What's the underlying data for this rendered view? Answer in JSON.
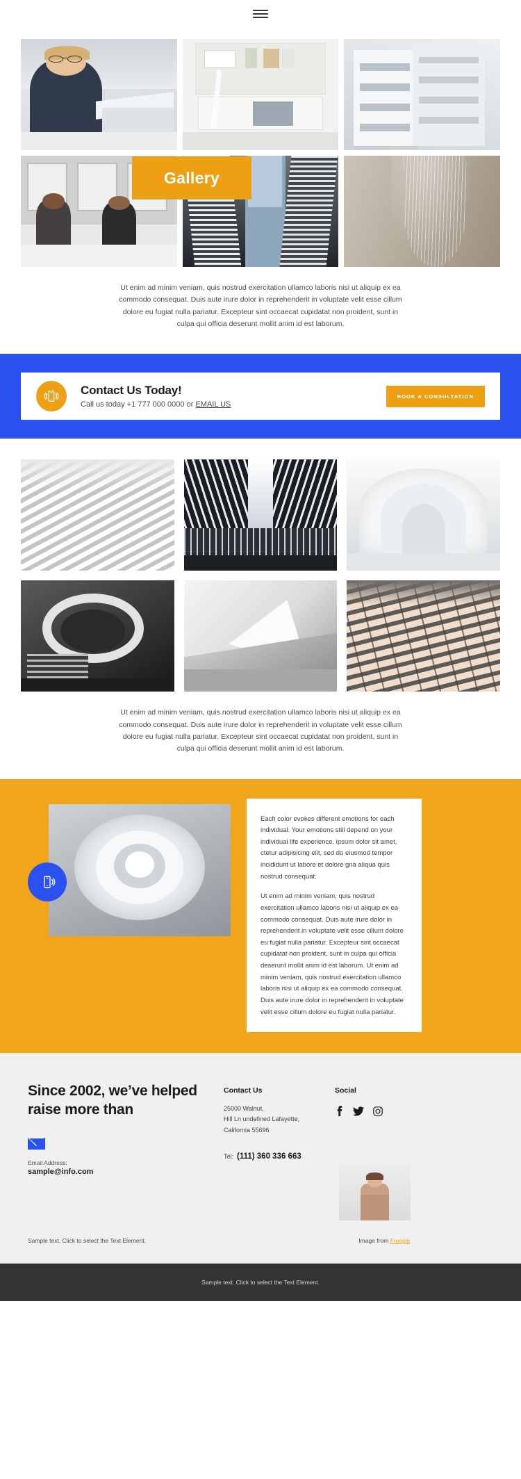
{
  "nav": {
    "menu_icon": "hamburger-icon"
  },
  "gallery": {
    "banner_label": "Gallery",
    "banner_color": "#eda014",
    "tiles": [
      {
        "alt": "Businesswoman smiling at desk with laptop"
      },
      {
        "alt": "Bright white office interior with shelves"
      },
      {
        "alt": "White modern apartment building facade"
      },
      {
        "alt": "Two women in a meeting taking notes"
      },
      {
        "alt": "Looking up at steel and glass skyscraper"
      },
      {
        "alt": "Curved beige architectural surface"
      }
    ],
    "caption": "Ut enim ad minim veniam, quis nostrud exercitation ullamco laboris nisi ut aliquip ex ea commodo consequat. Duis aute irure dolor in reprehenderit in voluptate velit esse cillum dolore eu fugiat nulla pariatur. Excepteur sint occaecat cupidatat non proident, sunt in culpa qui officia deserunt mollit anim id est laborum."
  },
  "cta": {
    "icon": "mobile-phone-ring-icon",
    "title": "Contact Us Today!",
    "line_prefix": "Call us today +1 777 000 0000 or ",
    "email_link": "EMAIL US",
    "button_label": "BOOK A CONSULTATION",
    "band_color": "#2b50f0",
    "button_color": "#eda014"
  },
  "gallery2": {
    "tiles": [
      {
        "alt": "White louvered facade diagonal"
      },
      {
        "alt": "Symmetrical white vaulted interior"
      },
      {
        "alt": "White curved corridor with arches"
      },
      {
        "alt": "Spiral staircase in black and white"
      },
      {
        "alt": "Abstract white folded geometric planes"
      },
      {
        "alt": "Balcony rows on beige apartment tower"
      }
    ],
    "caption": "Ut enim ad minim veniam, quis nostrud exercitation ullamco laboris nisi ut aliquip ex ea commodo consequat. Duis aute irure dolor in reprehenderit in voluptate velit esse cillum dolore eu fugiat nulla pariatur. Excepteur sint occaecat cupidatat non proident, sunt in culpa qui officia deserunt mollit anim id est laborum."
  },
  "feature": {
    "background_color": "#f0a51a",
    "badge_icon": "mobile-phone-ring-icon",
    "badge_color": "#2b50f0",
    "image_alt": "Looking up inside a white spiral stairwell",
    "paragraph_1": "Each color evokes different emotions for each individual. Your emotions still depend on your individual life experience. ipsum dolor sit amet, ctetur adipisicing elit, sed do eiusmod tempor incididunt ut labore et dolore gna aliqua quis nostrud consequat.",
    "paragraph_2": "Ut enim ad minim veniam, quis nostrud exercitation ullamco laboris nisi ut aliquip ex ea commodo consequat. Duis aute irure dolor in reprehenderit in voluptate velit esse cillum dolore eu fugiat nulla pariatur. Excepteur sint occaecat cupidatat non proident, sunt in culpa qui officia deserunt mollit anim id est laborum. Ut enim ad minim veniam, quis nostrud exercitation ullamco laboris nisi ut aliquip ex ea commodo consequat. Duis aute irure dolor in reprehenderit in voluptate velit esse cillum dolore eu fugiat nulla pariatur."
  },
  "footer": {
    "headline": "Since 2002, we’ve helped raise more than",
    "mail_icon": "envelope-icon",
    "email_label": "Email Address:",
    "email_value": "sample@info.com",
    "contact": {
      "title": "Contact Us",
      "address_line1": "25000 Walnut,",
      "address_line2": "Hill Ln undefined Lafayette,",
      "address_line3": "California 55696",
      "tel_label": "Tel:",
      "tel_value": "(111) 360 336 663"
    },
    "social": {
      "title": "Social",
      "items": [
        {
          "icon": "facebook-icon",
          "name": "Facebook"
        },
        {
          "icon": "twitter-icon",
          "name": "Twitter"
        },
        {
          "icon": "instagram-icon",
          "name": "Instagram"
        }
      ]
    },
    "photo_alt": "Woman in beige hoodie standing",
    "sample_text": "Sample text. Click to select the Text Element.",
    "image_from_prefix": "Image from ",
    "image_from_link": "Freepik",
    "bottom_text": "Sample text. Click to select the Text Element."
  }
}
